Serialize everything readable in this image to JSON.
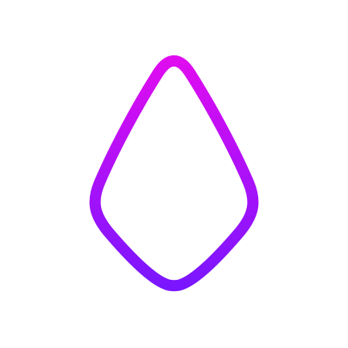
{
  "icon": {
    "name": "drop-outline-icon",
    "gradient_start": "#e00cf0",
    "gradient_end": "#7a16ff"
  },
  "background": "#ffffff"
}
